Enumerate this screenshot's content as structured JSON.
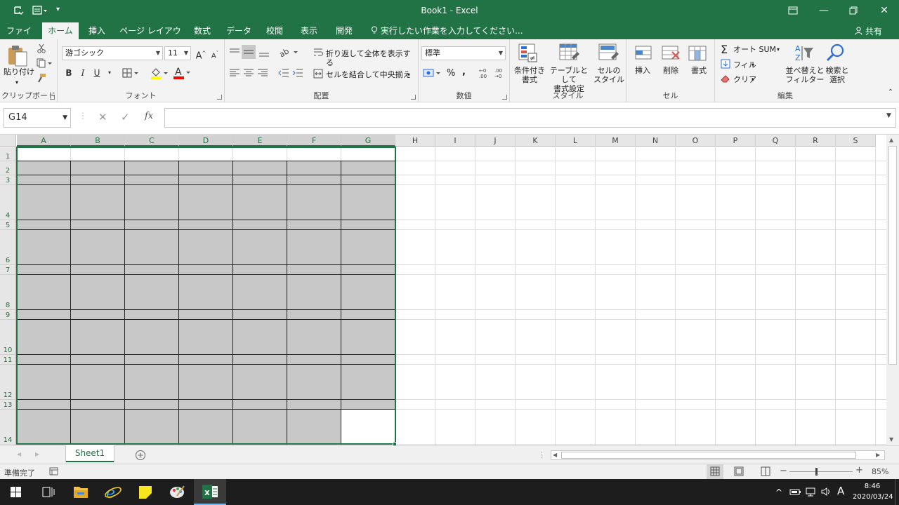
{
  "window": {
    "title": "Book1 - Excel"
  },
  "tabs": [
    "ファイル",
    "ホーム",
    "挿入",
    "ページ レイアウト",
    "数式",
    "データ",
    "校閲",
    "表示",
    "開発"
  ],
  "active_tab": "ホーム",
  "tell_me": "実行したい作業を入力してください...",
  "share": "共有",
  "ribbon": {
    "clipboard": {
      "label": "クリップボード",
      "paste": "貼り付け"
    },
    "font": {
      "label": "フォント",
      "name": "游ゴシック",
      "size": "11",
      "grow": "A",
      "shrink": "A",
      "bold": "B",
      "italic": "I",
      "underline": "U",
      "color_letter": "A",
      "fill_color": "#ffff00",
      "font_color": "#ff0000"
    },
    "alignment": {
      "label": "配置",
      "wrap": "折り返して全体を表示する",
      "merge": "セルを結合して中央揃え"
    },
    "number": {
      "label": "数値",
      "format": "標準",
      "percent": "%",
      "comma": ","
    },
    "styles": {
      "label": "スタイル",
      "conditional": [
        "条件付き",
        "書式"
      ],
      "table": [
        "テーブルとして",
        "書式設定"
      ],
      "cell": [
        "セルの",
        "スタイル"
      ]
    },
    "cells": {
      "label": "セル",
      "insert": "挿入",
      "delete": "削除",
      "format": "書式"
    },
    "editing": {
      "label": "編集",
      "autosum": "オート SUM",
      "fill": "フィル",
      "clear": "クリア",
      "sort": [
        "並べ替えと",
        "フィルター"
      ],
      "find": [
        "検索と",
        "選択"
      ]
    }
  },
  "formula_bar": {
    "name_box": "G14",
    "value": ""
  },
  "columns": [
    "A",
    "B",
    "C",
    "D",
    "E",
    "F",
    "G",
    "H",
    "I",
    "J",
    "K",
    "L",
    "M",
    "N",
    "O",
    "P",
    "Q",
    "R",
    "S"
  ],
  "rows": [
    "1",
    "2",
    "3",
    "4",
    "5",
    "6",
    "7",
    "8",
    "9",
    "10",
    "11",
    "12",
    "13",
    "14"
  ],
  "selection": {
    "range": "A1:G14",
    "active_cell": "G14"
  },
  "sheets": [
    "Sheet1"
  ],
  "status": {
    "ready": "準備完了",
    "zoom": "85%"
  },
  "taskbar": {
    "time": "8:46",
    "date": "2020/03/24",
    "ime": "A"
  },
  "colors": {
    "excel_green": "#217346",
    "cell_fill": "#c8c8c8"
  }
}
